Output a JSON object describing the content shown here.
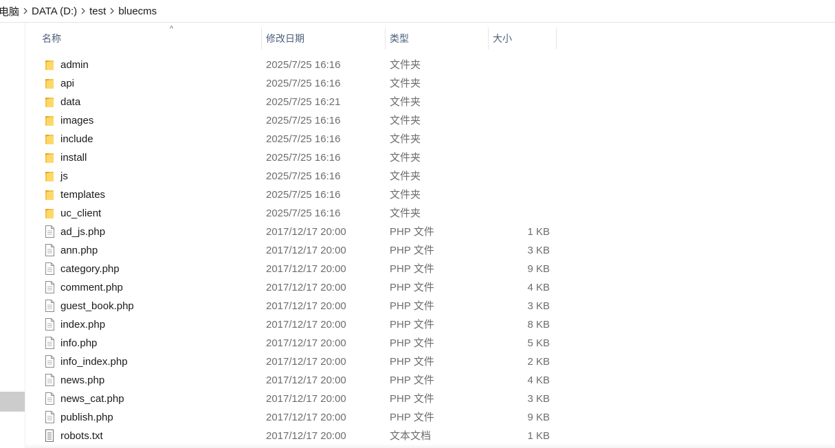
{
  "breadcrumb": [
    "电脑",
    "DATA (D:)",
    "test",
    "bluecms"
  ],
  "columns": {
    "name": "名称",
    "date": "修改日期",
    "type": "类型",
    "size": "大小"
  },
  "files": [
    {
      "name": "admin",
      "date": "2025/7/25 16:16",
      "type": "文件夹",
      "size": "",
      "icon": "folder-icon"
    },
    {
      "name": "api",
      "date": "2025/7/25 16:16",
      "type": "文件夹",
      "size": "",
      "icon": "folder-icon"
    },
    {
      "name": "data",
      "date": "2025/7/25 16:21",
      "type": "文件夹",
      "size": "",
      "icon": "folder-icon"
    },
    {
      "name": "images",
      "date": "2025/7/25 16:16",
      "type": "文件夹",
      "size": "",
      "icon": "folder-icon"
    },
    {
      "name": "include",
      "date": "2025/7/25 16:16",
      "type": "文件夹",
      "size": "",
      "icon": "folder-icon"
    },
    {
      "name": "install",
      "date": "2025/7/25 16:16",
      "type": "文件夹",
      "size": "",
      "icon": "folder-icon"
    },
    {
      "name": "js",
      "date": "2025/7/25 16:16",
      "type": "文件夹",
      "size": "",
      "icon": "folder-icon"
    },
    {
      "name": "templates",
      "date": "2025/7/25 16:16",
      "type": "文件夹",
      "size": "",
      "icon": "folder-icon"
    },
    {
      "name": "uc_client",
      "date": "2025/7/25 16:16",
      "type": "文件夹",
      "size": "",
      "icon": "folder-icon"
    },
    {
      "name": "ad_js.php",
      "date": "2017/12/17 20:00",
      "type": "PHP 文件",
      "size": "1 KB",
      "icon": "file-icon"
    },
    {
      "name": "ann.php",
      "date": "2017/12/17 20:00",
      "type": "PHP 文件",
      "size": "3 KB",
      "icon": "file-icon"
    },
    {
      "name": "category.php",
      "date": "2017/12/17 20:00",
      "type": "PHP 文件",
      "size": "9 KB",
      "icon": "file-icon"
    },
    {
      "name": "comment.php",
      "date": "2017/12/17 20:00",
      "type": "PHP 文件",
      "size": "4 KB",
      "icon": "file-icon"
    },
    {
      "name": "guest_book.php",
      "date": "2017/12/17 20:00",
      "type": "PHP 文件",
      "size": "3 KB",
      "icon": "file-icon"
    },
    {
      "name": "index.php",
      "date": "2017/12/17 20:00",
      "type": "PHP 文件",
      "size": "8 KB",
      "icon": "file-icon"
    },
    {
      "name": "info.php",
      "date": "2017/12/17 20:00",
      "type": "PHP 文件",
      "size": "5 KB",
      "icon": "file-icon"
    },
    {
      "name": "info_index.php",
      "date": "2017/12/17 20:00",
      "type": "PHP 文件",
      "size": "2 KB",
      "icon": "file-icon"
    },
    {
      "name": "news.php",
      "date": "2017/12/17 20:00",
      "type": "PHP 文件",
      "size": "4 KB",
      "icon": "file-icon"
    },
    {
      "name": "news_cat.php",
      "date": "2017/12/17 20:00",
      "type": "PHP 文件",
      "size": "3 KB",
      "icon": "file-icon"
    },
    {
      "name": "publish.php",
      "date": "2017/12/17 20:00",
      "type": "PHP 文件",
      "size": "9 KB",
      "icon": "file-icon"
    },
    {
      "name": "robots.txt",
      "date": "2017/12/17 20:00",
      "type": "文本文档",
      "size": "1 KB",
      "icon": "text-file-icon"
    }
  ]
}
